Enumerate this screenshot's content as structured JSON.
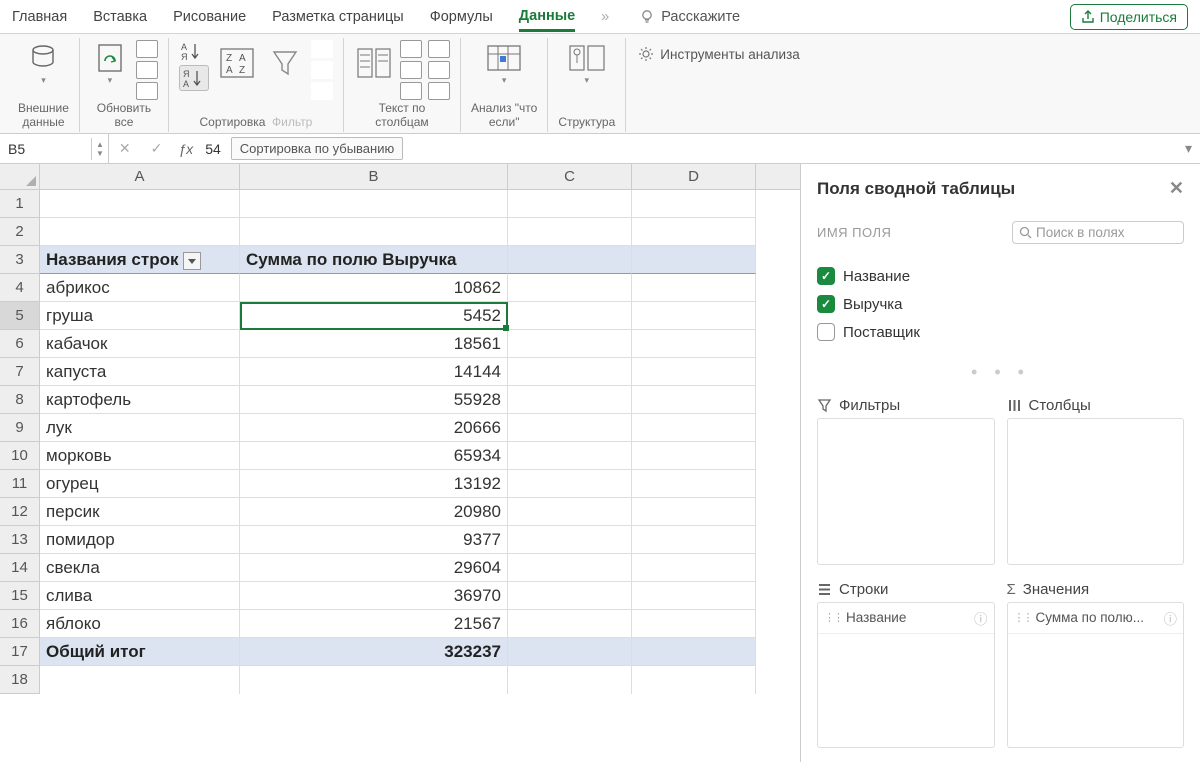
{
  "tabs": {
    "home": "Главная",
    "insert": "Вставка",
    "draw": "Рисование",
    "layout": "Разметка страницы",
    "formulas": "Формулы",
    "data": "Данные",
    "more": "»",
    "tellme": "Расскажите",
    "share": "Поделиться"
  },
  "ribbon": {
    "external": "Внешние\nданные",
    "refresh": "Обновить\nвсе",
    "sort": "Сортировка",
    "filter": "Фильтр",
    "textcol": "Текст по\nстолбцам",
    "whatif": "Анализ \"что\nесли\"",
    "structure": "Структура",
    "tools": "Инструменты анализа"
  },
  "formula": {
    "cell": "B5",
    "value": "54",
    "tooltip": "Сортировка по убыванию"
  },
  "columns": [
    "A",
    "B",
    "C",
    "D"
  ],
  "pivot": {
    "header_a": "Названия строк",
    "header_b": "Сумма по полю Выручка",
    "rows": [
      {
        "n": "4",
        "a": "абрикос",
        "b": "10862"
      },
      {
        "n": "5",
        "a": "груша",
        "b": "5452"
      },
      {
        "n": "6",
        "a": "кабачок",
        "b": "18561"
      },
      {
        "n": "7",
        "a": "капуста",
        "b": "14144"
      },
      {
        "n": "8",
        "a": "картофель",
        "b": "55928"
      },
      {
        "n": "9",
        "a": "лук",
        "b": "20666"
      },
      {
        "n": "10",
        "a": "морковь",
        "b": "65934"
      },
      {
        "n": "11",
        "a": "огурец",
        "b": "13192"
      },
      {
        "n": "12",
        "a": "персик",
        "b": "20980"
      },
      {
        "n": "13",
        "a": "помидор",
        "b": "9377"
      },
      {
        "n": "14",
        "a": "свекла",
        "b": "29604"
      },
      {
        "n": "15",
        "a": "слива",
        "b": "36970"
      },
      {
        "n": "16",
        "a": "яблоко",
        "b": "21567"
      }
    ],
    "total_label": "Общий итог",
    "total_value": "323237"
  },
  "panel": {
    "title": "Поля сводной таблицы",
    "fieldname": "ИМЯ ПОЛЯ",
    "search_ph": "Поиск в полях",
    "f1": "Название",
    "f2": "Выручка",
    "f3": "Поставщик",
    "filters": "Фильтры",
    "columns": "Столбцы",
    "rows": "Строки",
    "values": "Значения",
    "row_item": "Название",
    "val_item": "Сумма по полю..."
  }
}
